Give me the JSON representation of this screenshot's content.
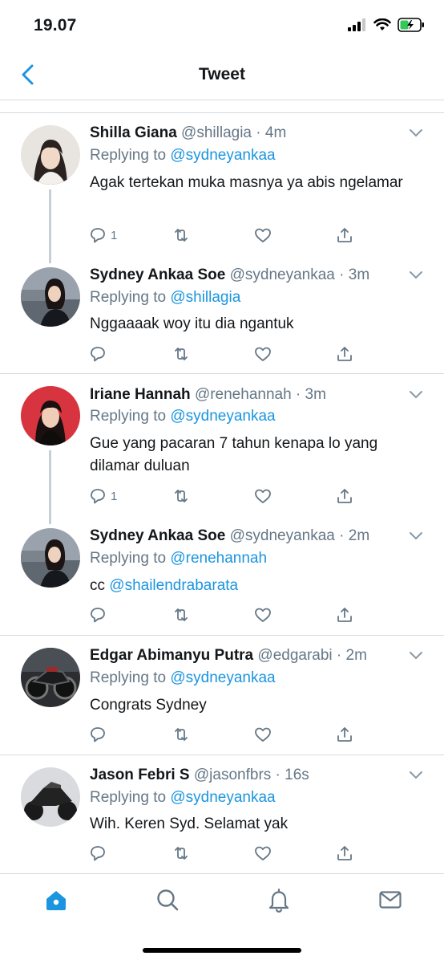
{
  "status": {
    "time": "19.07"
  },
  "nav": {
    "title": "Tweet"
  },
  "colors": {
    "accent": "#1b95e0",
    "muted": "#657786",
    "text": "#14171a"
  },
  "tweets": [
    {
      "name": "Shilla Giana",
      "handle": "@shillagia",
      "sep": " · ",
      "time": "4m",
      "replying_prefix": "Replying to ",
      "replying_to": "@sydneyankaa",
      "text": "Agak tertekan muka masnya ya abis ngelamar",
      "reply_count": "1",
      "avatar_icon": "avatar-woman-light"
    },
    {
      "name": "Sydney Ankaa Soe",
      "handle": "@sydneyankaa",
      "sep": " · ",
      "time": "3m",
      "replying_prefix": "Replying to ",
      "replying_to": "@shillagia",
      "text": "Nggaaaak woy itu dia ngantuk",
      "reply_count": "",
      "avatar_icon": "avatar-woman-rooftop"
    },
    {
      "name": "Iriane Hannah",
      "handle": "@renehannah",
      "sep": " · ",
      "time": "3m",
      "replying_prefix": "Replying to ",
      "replying_to": "@sydneyankaa",
      "text": "Gue yang pacaran 7 tahun kenapa lo yang dilamar duluan",
      "reply_count": "1",
      "avatar_icon": "avatar-woman-red"
    },
    {
      "name": "Sydney Ankaa Soe",
      "handle": "@sydneyankaa",
      "sep": " · ",
      "time": "2m",
      "replying_prefix": "Replying to ",
      "replying_to": "@renehannah",
      "text_prefix": "cc ",
      "text_mention": "@shailendrabarata",
      "reply_count": "",
      "avatar_icon": "avatar-woman-rooftop"
    },
    {
      "name": "Edgar Abimanyu Putra",
      "handle": "@edgarabi",
      "sep": " · ",
      "time": "2m",
      "replying_prefix": "Replying to ",
      "replying_to": "@sydneyankaa",
      "text": "Congrats Sydney",
      "reply_count": "",
      "avatar_icon": "avatar-motorcycle"
    },
    {
      "name": "Jason Febri S",
      "handle": "@jasonfbrs",
      "sep": " · ",
      "time": "16s",
      "replying_prefix": "Replying to ",
      "replying_to": "@sydneyankaa",
      "text": "Wih. Keren Syd. Selamat yak",
      "reply_count": "",
      "avatar_icon": "avatar-motorcycle-dark"
    }
  ],
  "tabs": [
    "home-icon",
    "search-icon",
    "notifications-icon",
    "messages-icon"
  ]
}
